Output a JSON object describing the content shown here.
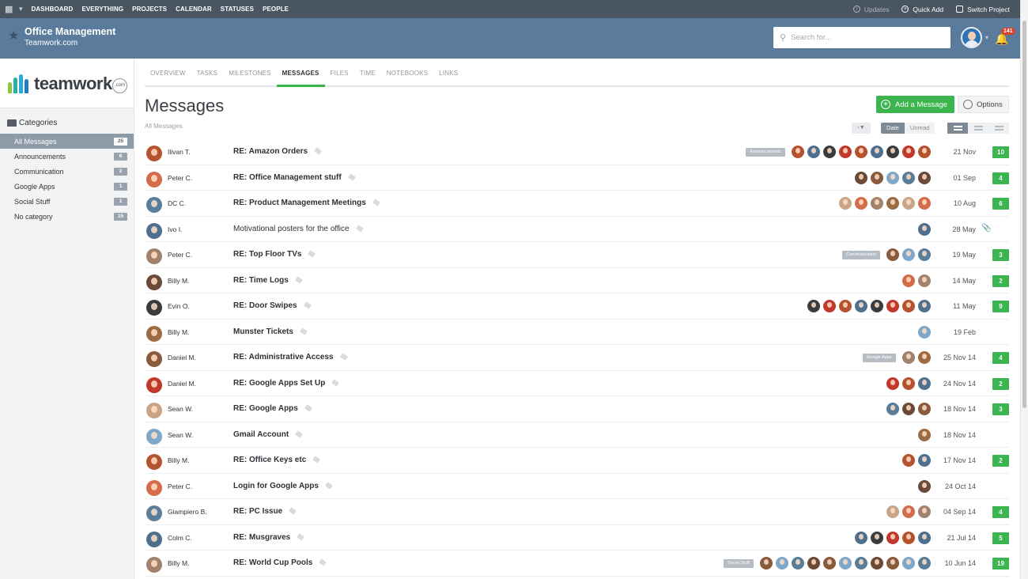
{
  "topnav": {
    "links": [
      "DASHBOARD",
      "EVERYTHING",
      "PROJECTS",
      "CALENDAR",
      "STATUSES",
      "PEOPLE"
    ],
    "updates": "Updates",
    "quick_add": "Quick Add",
    "switch_project": "Switch Project"
  },
  "project": {
    "title": "Office Management",
    "subtitle": "Teamwork.com"
  },
  "search": {
    "placeholder": "Search for..."
  },
  "notifications": {
    "count": "141"
  },
  "brand": {
    "word": "teamwork",
    "dotcom": ".com"
  },
  "sidebar": {
    "header": "Categories",
    "items": [
      {
        "label": "All Messages",
        "count": "25",
        "active": true
      },
      {
        "label": "Announcements",
        "count": "6"
      },
      {
        "label": "Communication",
        "count": "2"
      },
      {
        "label": "Google Apps",
        "count": "1"
      },
      {
        "label": "Social Stuff",
        "count": "1"
      },
      {
        "label": "No category",
        "count": "15"
      }
    ]
  },
  "tabs": [
    "OVERVIEW",
    "TASKS",
    "MILESTONES",
    "MESSAGES",
    "FILES",
    "TIME",
    "NOTEBOOKS",
    "LINKS"
  ],
  "active_tab": "MESSAGES",
  "page": {
    "title": "Messages",
    "breadcrumb": "All Messages",
    "add_button": "Add a Message",
    "options_button": "Options",
    "sort_date": "Date",
    "sort_unread": "Unread"
  },
  "colors": {
    "accent_green": "#3cb44f",
    "header_blue": "#5b7b9c",
    "topbar": "#4a5562"
  },
  "messages": [
    {
      "author": "Ilivan T.",
      "subject": "RE: Amazon Orders",
      "bold": true,
      "category": "Announcements",
      "participants": 9,
      "date": "21 Nov",
      "replies": "10"
    },
    {
      "author": "Peter C.",
      "subject": "RE: Office Management stuff",
      "bold": true,
      "category": "",
      "participants": 5,
      "date": "01 Sep",
      "replies": "4"
    },
    {
      "author": "DC C.",
      "subject": "RE: Product Management Meetings",
      "bold": true,
      "category": "",
      "participants": 6,
      "date": "10 Aug",
      "replies": "6"
    },
    {
      "author": "Ivo I.",
      "subject": "Motivational posters for the office",
      "bold": false,
      "category": "",
      "participants": 1,
      "date": "28 May",
      "replies": "",
      "attachment": true
    },
    {
      "author": "Peter C.",
      "subject": "RE: Top Floor TVs",
      "bold": true,
      "category": "Communication",
      "participants": 3,
      "date": "19 May",
      "replies": "3"
    },
    {
      "author": "Billy M.",
      "subject": "RE: Time Logs",
      "bold": true,
      "category": "",
      "participants": 2,
      "date": "14 May",
      "replies": "2"
    },
    {
      "author": "Evin O.",
      "subject": "RE: Door Swipes",
      "bold": true,
      "category": "",
      "participants": 8,
      "date": "11 May",
      "replies": "9"
    },
    {
      "author": "Billy M.",
      "subject": "Munster Tickets",
      "bold": true,
      "category": "",
      "participants": 1,
      "date": "19 Feb",
      "replies": ""
    },
    {
      "author": "Daniel M.",
      "subject": "RE: Administrative Access",
      "bold": true,
      "category": "Google Apps",
      "participants": 2,
      "date": "25 Nov 14",
      "replies": "4"
    },
    {
      "author": "Daniel M.",
      "subject": "RE: Google Apps Set Up",
      "bold": true,
      "category": "",
      "participants": 3,
      "date": "24 Nov 14",
      "replies": "2"
    },
    {
      "author": "Sean W.",
      "subject": "RE: Google Apps",
      "bold": true,
      "category": "",
      "participants": 3,
      "date": "18 Nov 14",
      "replies": "3"
    },
    {
      "author": "Sean W.",
      "subject": "Gmail Account",
      "bold": true,
      "category": "",
      "participants": 1,
      "date": "18 Nov 14",
      "replies": ""
    },
    {
      "author": "Billy M.",
      "subject": "RE: Office Keys etc",
      "bold": true,
      "category": "",
      "participants": 2,
      "date": "17 Nov 14",
      "replies": "2"
    },
    {
      "author": "Peter C.",
      "subject": "Login for Google Apps",
      "bold": true,
      "category": "",
      "participants": 1,
      "date": "24 Oct 14",
      "replies": ""
    },
    {
      "author": "Giampiero B.",
      "subject": "RE: PC Issue",
      "bold": true,
      "category": "",
      "participants": 3,
      "date": "04 Sep 14",
      "replies": "4"
    },
    {
      "author": "Colm C.",
      "subject": "RE: Musgraves",
      "bold": true,
      "category": "",
      "participants": 5,
      "date": "21 Jul 14",
      "replies": "5"
    },
    {
      "author": "Billy M.",
      "subject": "RE: World Cup Pools",
      "bold": true,
      "category": "Social Stuff",
      "participants": 11,
      "date": "10 Jun 14",
      "replies": "19"
    }
  ]
}
